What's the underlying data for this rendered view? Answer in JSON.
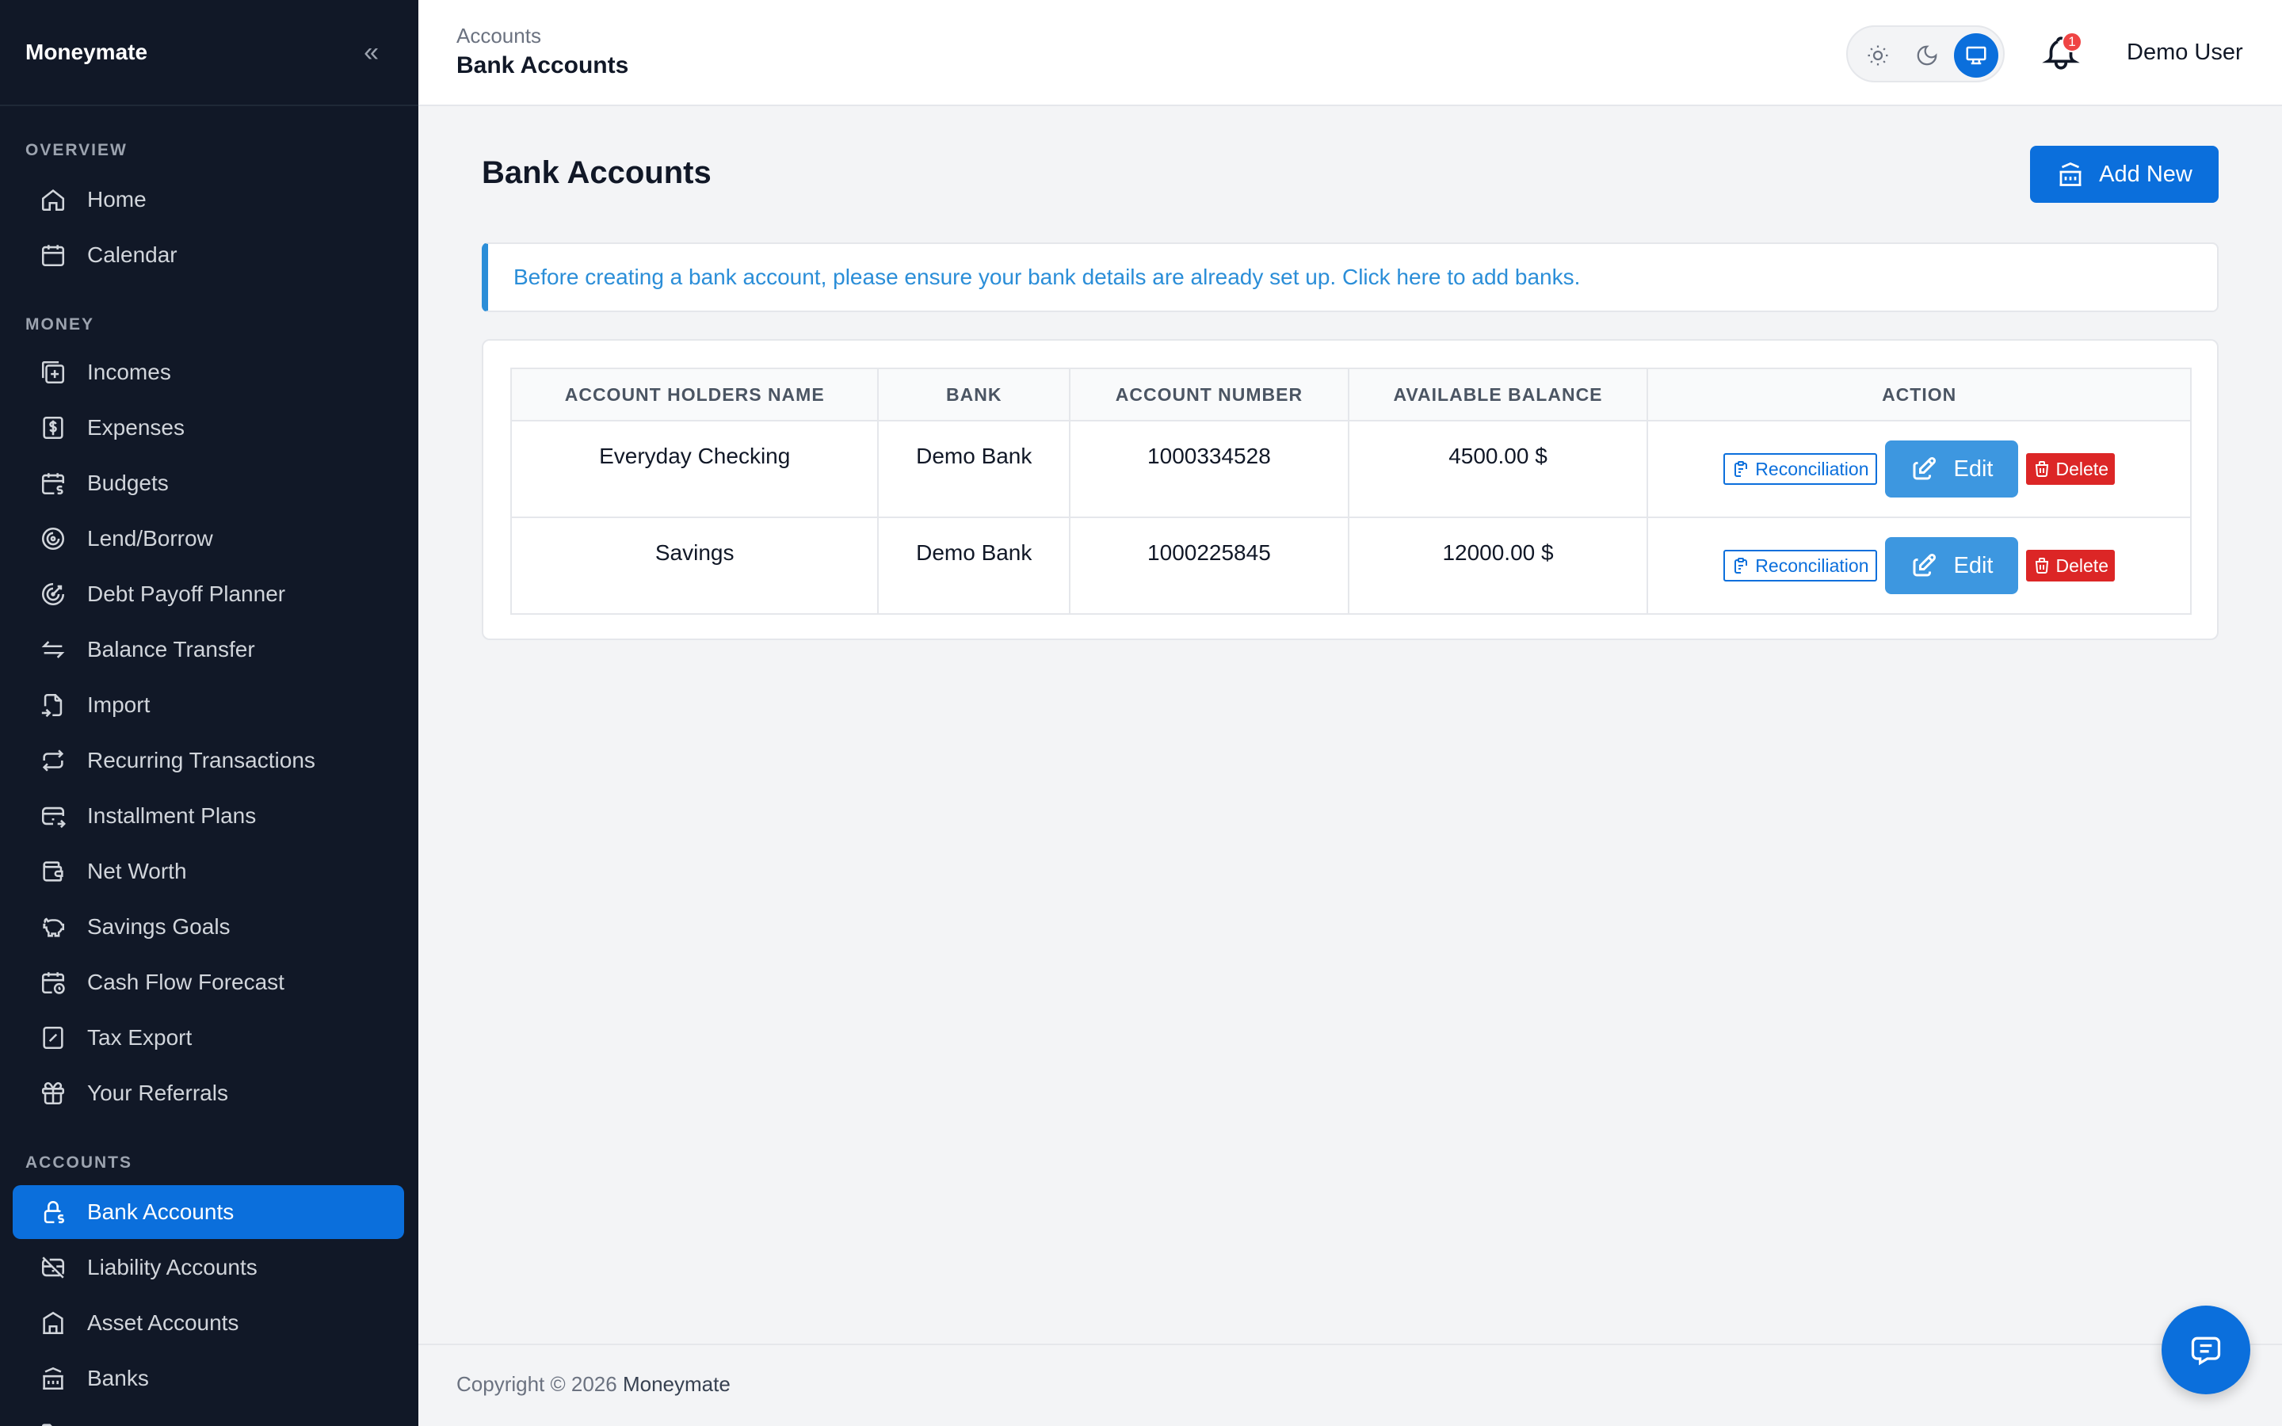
{
  "sidebar": {
    "brand": "Moneymate",
    "collapse_icon": "chevrons-left-icon",
    "sections": {
      "overview": "OVERVIEW",
      "money": "MONEY",
      "accounts": "ACCOUNTS"
    },
    "items": {
      "home": "Home",
      "calendar": "Calendar",
      "incomes": "Incomes",
      "expenses": "Expenses",
      "budgets": "Budgets",
      "lend_borrow": "Lend/Borrow",
      "debt_payoff": "Debt Payoff Planner",
      "balance_transfer": "Balance Transfer",
      "import": "Import",
      "recurring": "Recurring Transactions",
      "installment": "Installment Plans",
      "net_worth": "Net Worth",
      "savings_goals": "Savings Goals",
      "cash_flow": "Cash Flow Forecast",
      "tax_export": "Tax Export",
      "referrals": "Your Referrals",
      "bank_accounts": "Bank Accounts",
      "liability_accounts": "Liability Accounts",
      "asset_accounts": "Asset Accounts",
      "banks": "Banks"
    },
    "active_item": "Bank Accounts",
    "accent_color": "#0b6fdc"
  },
  "header": {
    "breadcrumb_parent": "Accounts",
    "breadcrumb_current": "Bank Accounts",
    "theme_modes": [
      "light",
      "dark",
      "system"
    ],
    "theme_selected": "system",
    "notification_count": "1",
    "user_name": "Demo User"
  },
  "main": {
    "title": "Bank Accounts",
    "add_new_label": "Add New",
    "alert_text": "Before creating a bank account, please ensure your bank details are already set up. Click here to add banks.",
    "table": {
      "columns": [
        "ACCOUNT HOLDERS NAME",
        "BANK",
        "ACCOUNT NUMBER",
        "AVAILABLE BALANCE",
        "ACTION"
      ],
      "rows": [
        {
          "name": "Everyday Checking",
          "bank": "Demo Bank",
          "number": "1000334528",
          "balance": "4500.00 $"
        },
        {
          "name": "Savings",
          "bank": "Demo Bank",
          "number": "1000225845",
          "balance": "12000.00 $"
        }
      ],
      "actions": {
        "reconciliation": "Reconciliation",
        "edit": "Edit",
        "delete": "Delete"
      }
    }
  },
  "footer": {
    "copyright": "Copyright © 2026 ",
    "brand": "Moneymate"
  },
  "colors": {
    "primary": "#0b6fdc",
    "edit": "#3d97e0",
    "danger": "#dc2626",
    "info": "#2b8ed8",
    "sidebar_bg": "#111827"
  }
}
